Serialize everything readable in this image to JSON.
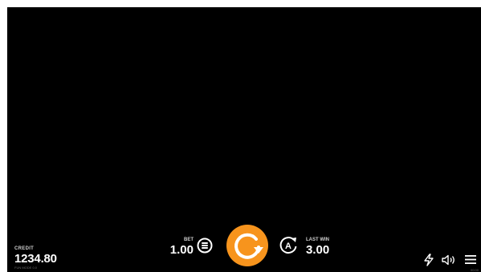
{
  "hud": {
    "credit_label": "CREDIT",
    "credit_value": "1234.80",
    "credit_sub": "FUN MODE 0.0",
    "bet_label": "BET",
    "bet_value": "1.00",
    "last_win_label": "LAST WIN",
    "last_win_value": "3.00",
    "clock": "00:00"
  },
  "icons": {
    "bet": "coin-stack-icon",
    "spin": "spin-arrow-icon",
    "autoplay": "autoplay-icon",
    "turbo": "lightning-icon",
    "sound": "speaker-icon",
    "menu": "hamburger-menu-icon"
  },
  "colors": {
    "background": "#000000",
    "accent": "#f7941d",
    "text": "#ffffff",
    "label": "#cfcfcf"
  }
}
